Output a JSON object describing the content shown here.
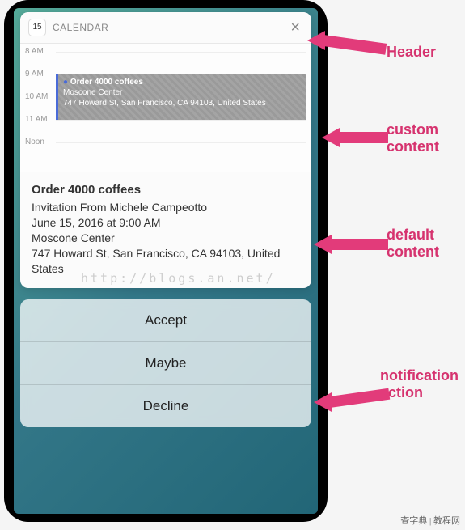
{
  "header": {
    "app_name": "CALENDAR",
    "icon_day": "15",
    "close_glyph": "×"
  },
  "timeline": {
    "labels": [
      "8 AM",
      "9 AM",
      "10 AM",
      "11 AM",
      "Noon"
    ],
    "event": {
      "title": "Order 4000 coffees",
      "venue": "Moscone Center",
      "address": "747 Howard St, San Francisco, CA  94103, United States"
    }
  },
  "detail": {
    "title": "Order 4000 coffees",
    "invitation": "Invitation From Michele Campeotto",
    "datetime": "June 15, 2016 at 9:00 AM",
    "venue": "Moscone Center",
    "address": "747 Howard St, San Francisco, CA  94103, United States"
  },
  "actions": [
    "Accept",
    "Maybe",
    "Decline"
  ],
  "annotations": {
    "header": "Header",
    "custom": "custom content",
    "default": "default content",
    "action": "notification action"
  },
  "watermark_br": "查字典 | 教程网",
  "watermark_center": "http://blogs.an.net/"
}
